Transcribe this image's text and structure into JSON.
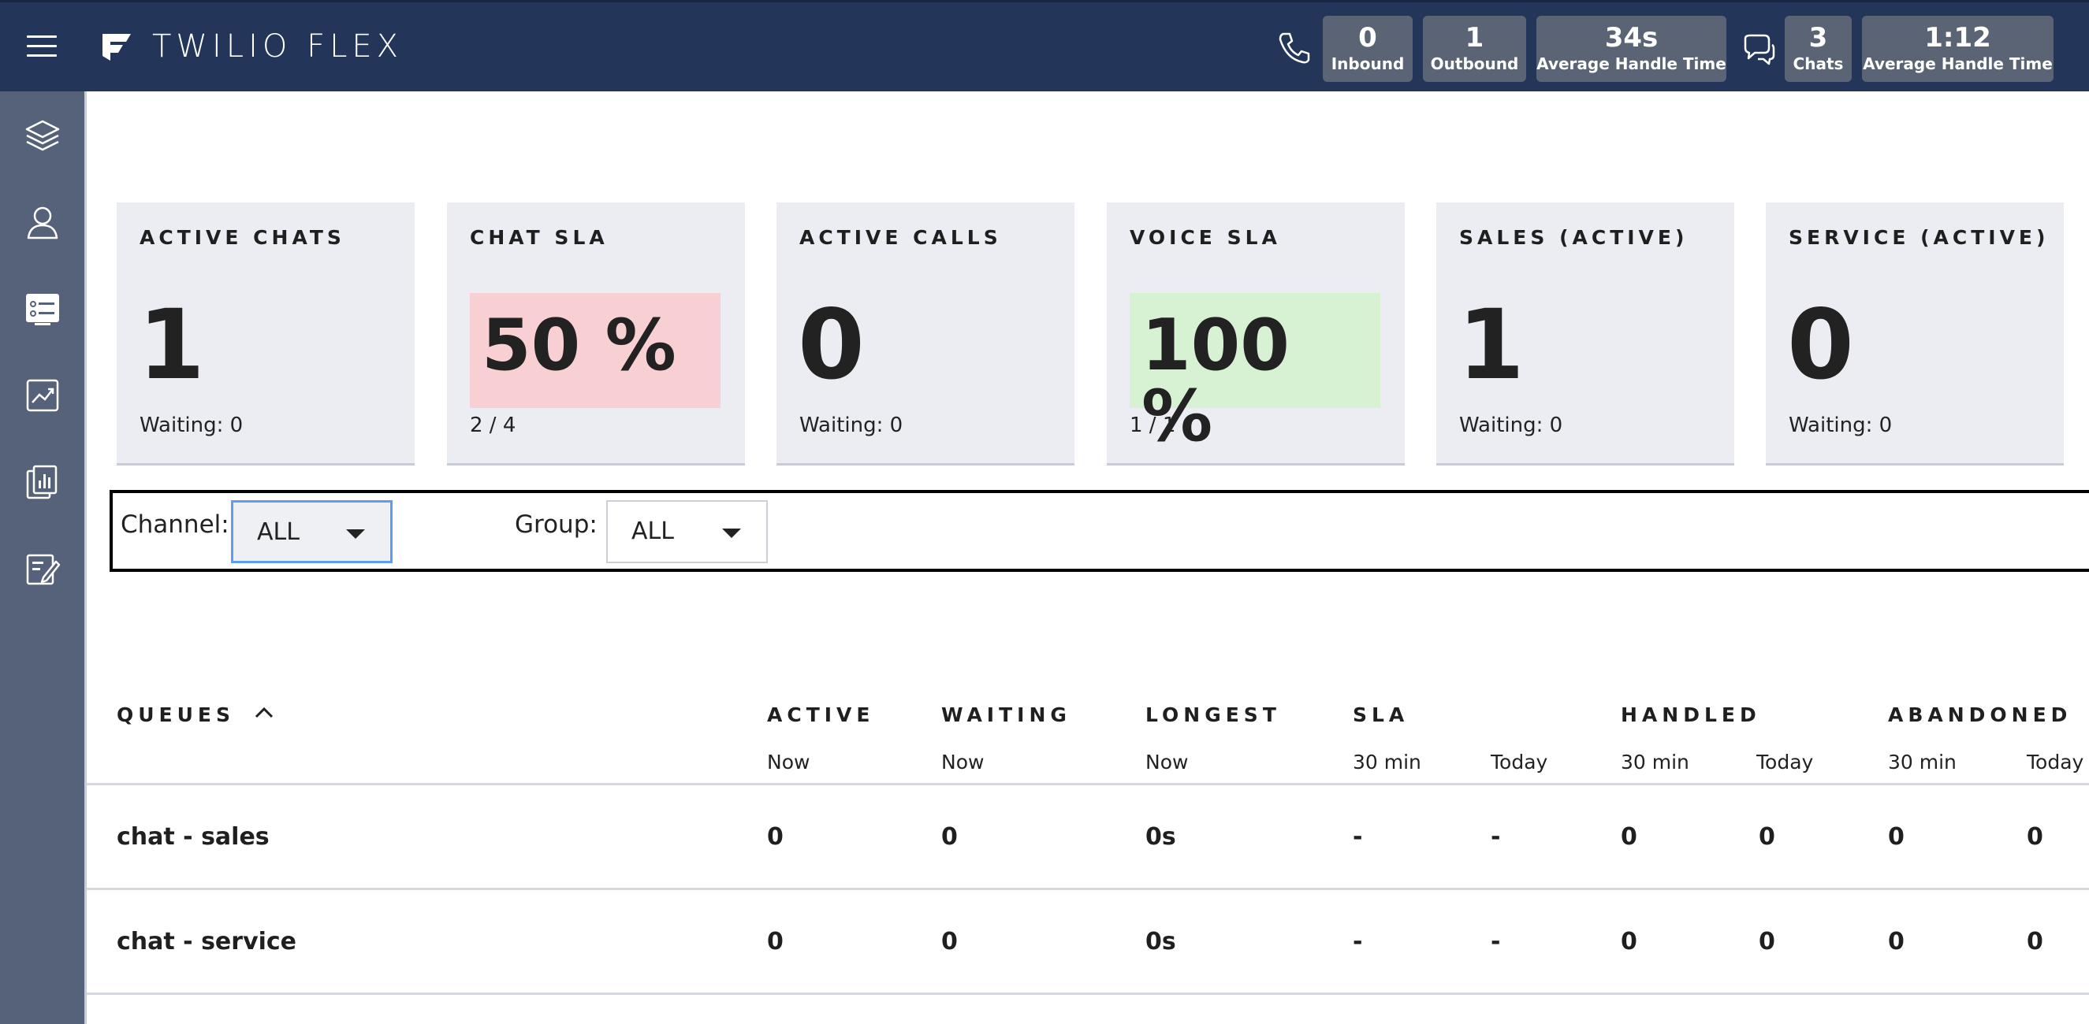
{
  "header": {
    "brand": "TWILIO FLEX",
    "voice_stats": [
      {
        "value": "0",
        "label": "Inbound"
      },
      {
        "value": "1",
        "label": "Outbound"
      },
      {
        "value": "34s",
        "label": "Average Handle Time"
      }
    ],
    "chat_stats": [
      {
        "value": "3",
        "label": "Chats"
      },
      {
        "value": "1:12",
        "label": "Average Handle Time"
      }
    ]
  },
  "sidebar": {
    "items": [
      {
        "icon": "layers-icon"
      },
      {
        "icon": "agents-icon"
      },
      {
        "icon": "queues-stats-icon",
        "active": true
      },
      {
        "icon": "analytics-icon"
      },
      {
        "icon": "reports-icon"
      },
      {
        "icon": "quality-icon"
      }
    ]
  },
  "cards": [
    {
      "title": "ACTIVE CHATS",
      "value": "1",
      "sub": "Waiting: 0"
    },
    {
      "title": "CHAT SLA",
      "value": "50 %",
      "sub": "2 / 4",
      "highlight": "#f8d0d3"
    },
    {
      "title": "ACTIVE CALLS",
      "value": "0",
      "sub": "Waiting: 0"
    },
    {
      "title": "VOICE SLA",
      "value": "100 %",
      "sub": "1 / 1",
      "highlight": "#d6f2d3"
    },
    {
      "title": "SALES (ACTIVE)",
      "value": "1",
      "sub": "Waiting: 0"
    },
    {
      "title": "SERVICE (ACTIVE)",
      "value": "0",
      "sub": "Waiting: 0"
    }
  ],
  "filters": {
    "channel_label": "Channel:",
    "channel_value": "ALL",
    "group_label": "Group:",
    "group_value": "ALL"
  },
  "table": {
    "headers": [
      "QUEUES",
      "ACTIVE",
      "WAITING",
      "LONGEST",
      "SLA",
      "HANDLED",
      "ABANDONED"
    ],
    "subheaders": [
      "Now",
      "Now",
      "Now",
      "30 min",
      "Today",
      "30 min",
      "Today",
      "30 min",
      "Today"
    ],
    "rows": [
      {
        "name": "chat - sales",
        "cells": [
          "0",
          "0",
          "0s",
          "-",
          "-",
          "0",
          "0",
          "0",
          "0"
        ]
      },
      {
        "name": "chat - service",
        "cells": [
          "0",
          "0",
          "0s",
          "-",
          "-",
          "0",
          "0",
          "0",
          "0"
        ]
      }
    ]
  },
  "colors": {
    "topbar": "#233659",
    "sidebar": "#566279",
    "stat_chip": "#5a6474",
    "sla_bad": "#f8d0d3",
    "sla_good": "#d6f2d3",
    "card_bg": "#ebedf2"
  }
}
